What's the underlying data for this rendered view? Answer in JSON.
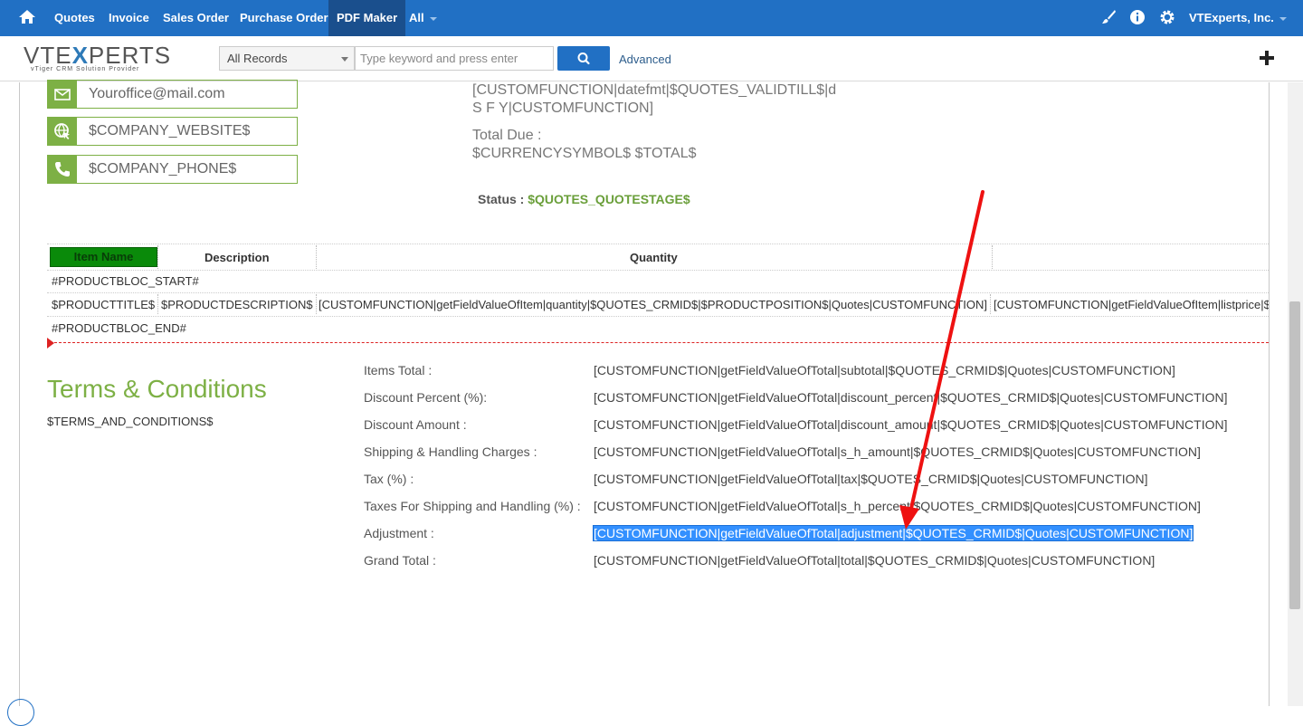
{
  "nav": {
    "items": [
      "Quotes",
      "Invoice",
      "Sales Order",
      "Purchase Order",
      "PDF Maker",
      "All"
    ],
    "active": "PDF Maker",
    "user": "VTExperts, Inc.",
    "icons": [
      "home-icon",
      "brush-icon",
      "info-icon",
      "gear-icon"
    ]
  },
  "header": {
    "logo_prefix": "VTE",
    "logo_x": "X",
    "logo_suffix": "PERTS",
    "logo_tagline": "vTiger CRM Solution Provider",
    "records_select": "All Records",
    "search_placeholder": "Type keyword and press enter",
    "advanced": "Advanced"
  },
  "contacts": {
    "email": "Youroffice@mail.com",
    "website": "$COMPANY_WEBSITE$",
    "phone": "$COMPANY_PHONE$"
  },
  "summary": {
    "validtill_line1": "[CUSTOMFUNCTION|datefmt|$QUOTES_VALIDTILL$|d",
    "validtill_line2": "S F Y|CUSTOMFUNCTION]",
    "total_due_label": "Total Due :",
    "total_due_value": "$CURRENCYSYMBOL$ $TOTAL$",
    "status_label": "Status :",
    "status_value": "$QUOTES_QUOTESTAGE$"
  },
  "product_table": {
    "headers": [
      "Item Name",
      "Description",
      "Quantity"
    ],
    "bloc_start": "#PRODUCTBLOC_START#",
    "row": [
      "$PRODUCTTITLE$",
      "$PRODUCTDESCRIPTION$",
      "[CUSTOMFUNCTION|getFieldValueOfItem|quantity|$QUOTES_CRMID$|$PRODUCTPOSITION$|Quotes|CUSTOMFUNCTION]",
      "[CUSTOMFUNCTION|getFieldValueOfItem|listprice|$"
    ],
    "bloc_end": "#PRODUCTBLOC_END#"
  },
  "terms": {
    "title": "Terms & Conditions",
    "variable": "$TERMS_AND_CONDITIONS$"
  },
  "totals": [
    {
      "label": "Items Total :",
      "value": "[CUSTOMFUNCTION|getFieldValueOfTotal|subtotal|$QUOTES_CRMID$|Quotes|CUSTOMFUNCTION]"
    },
    {
      "label": "Discount Percent (%):",
      "value": "[CUSTOMFUNCTION|getFieldValueOfTotal|discount_percent|$QUOTES_CRMID$|Quotes|CUSTOMFUNCTION]"
    },
    {
      "label": "Discount Amount :",
      "value": "[CUSTOMFUNCTION|getFieldValueOfTotal|discount_amount|$QUOTES_CRMID$|Quotes|CUSTOMFUNCTION]"
    },
    {
      "label": "Shipping & Handling Charges :",
      "value": "[CUSTOMFUNCTION|getFieldValueOfTotal|s_h_amount|$QUOTES_CRMID$|Quotes|CUSTOMFUNCTION]"
    },
    {
      "label": "Tax (%) :",
      "value": "[CUSTOMFUNCTION|getFieldValueOfTotal|tax|$QUOTES_CRMID$|Quotes|CUSTOMFUNCTION]"
    },
    {
      "label": "Taxes For Shipping and Handling (%) :",
      "value": "[CUSTOMFUNCTION|getFieldValueOfTotal|s_h_percent|$QUOTES_CRMID$|Quotes|CUSTOMFUNCTION]"
    },
    {
      "label": "Adjustment :",
      "value": "[CUSTOMFUNCTION|getFieldValueOfTotal|adjustment|$QUOTES_CRMID$|Quotes|CUSTOMFUNCTION]",
      "selected": true
    },
    {
      "label": "Grand Total :",
      "value": "[CUSTOMFUNCTION|getFieldValueOfTotal|total|$QUOTES_CRMID$|Quotes|CUSTOMFUNCTION]"
    }
  ],
  "colors": {
    "nav_bg": "#2170c4",
    "nav_active": "#1a4f8d",
    "accent_green": "#7db045",
    "selection": "#3390ff",
    "arrow": "#ee1111"
  }
}
